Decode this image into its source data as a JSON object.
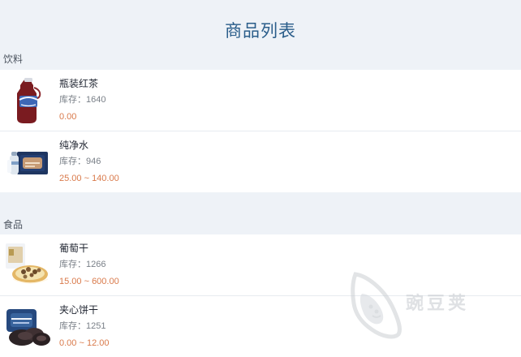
{
  "page": {
    "title": "商品列表"
  },
  "sections": [
    {
      "header": "饮料",
      "items": [
        {
          "name": "瓶装红茶",
          "stock_label": "库存：",
          "stock_value": "1640",
          "price": "0.00",
          "icon": "bottled-tea-icon"
        },
        {
          "name": "纯净水",
          "stock_label": "库存：",
          "stock_value": "946",
          "price": "25.00 ~ 140.00",
          "icon": "water-case-icon"
        }
      ]
    },
    {
      "header": "食品",
      "items": [
        {
          "name": "葡萄干",
          "stock_label": "库存：",
          "stock_value": "1266",
          "price": "15.00 ~ 600.00",
          "icon": "raisins-icon"
        },
        {
          "name": "夹心饼干",
          "stock_label": "库存：",
          "stock_value": "1251",
          "price": "0.00 ~ 12.00",
          "icon": "cookies-icon"
        }
      ]
    }
  ],
  "watermark": {
    "text": "豌豆荚",
    "icon": "pea-pod-watermark-icon"
  },
  "colors": {
    "background": "#eef2f7",
    "title": "#2a5d8a",
    "price": "#d97a4b",
    "card": "#ffffff"
  }
}
